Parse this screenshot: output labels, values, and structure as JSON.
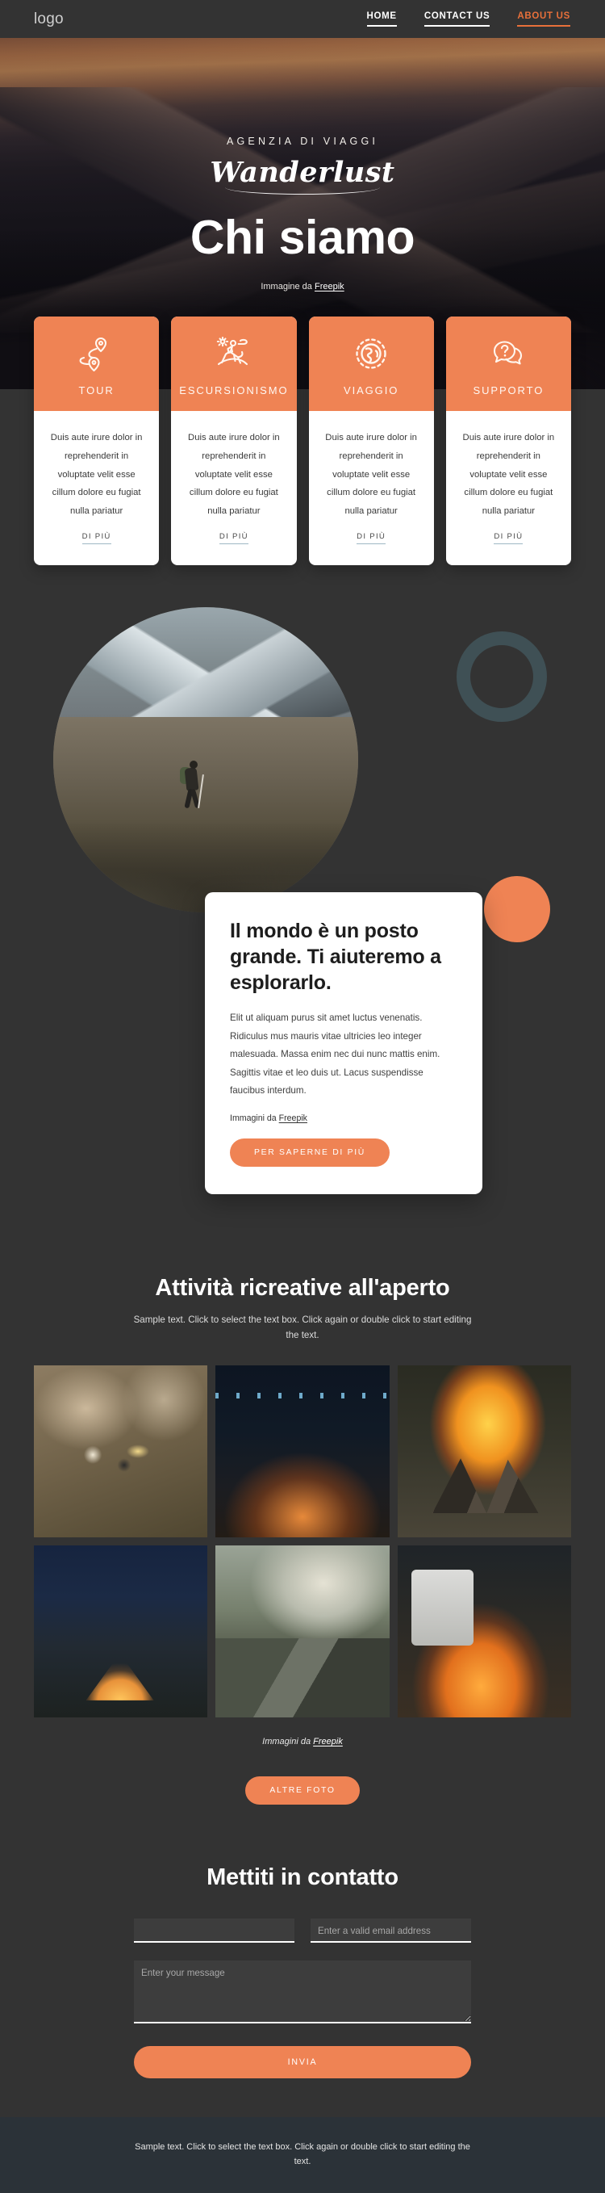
{
  "header": {
    "logo": "logo",
    "nav": [
      {
        "label": "HOME",
        "active": false
      },
      {
        "label": "CONTACT US",
        "active": false
      },
      {
        "label": "ABOUT US",
        "active": true
      }
    ]
  },
  "hero": {
    "eyebrow": "AGENZIA DI VIAGGI",
    "script": "Wanderlust",
    "title": "Chi siamo",
    "credit_prefix": "Immagine da ",
    "credit_link": "Freepik"
  },
  "features": [
    {
      "icon": "route-pin-icon",
      "title": "TOUR",
      "text": "Duis aute irure dolor in reprehenderit in voluptate velit esse cillum dolore eu fugiat nulla pariatur",
      "link": "DI PIÙ"
    },
    {
      "icon": "hiker-icon",
      "title": "ESCURSIONISMO",
      "text": "Duis aute irure dolor in reprehenderit in voluptate velit esse cillum dolore eu fugiat nulla pariatur",
      "link": "DI PIÙ"
    },
    {
      "icon": "globe-icon",
      "title": "VIAGGIO",
      "text": "Duis aute irure dolor in reprehenderit in voluptate velit esse cillum dolore eu fugiat nulla pariatur",
      "link": "DI PIÙ"
    },
    {
      "icon": "chat-question-icon",
      "title": "SUPPORTO",
      "text": "Duis aute irure dolor in reprehenderit in voluptate velit esse cillum dolore eu fugiat nulla pariatur",
      "link": "DI PIÙ"
    }
  ],
  "about": {
    "photo_alt": "hiker-crossing-mountain-valley-photo",
    "heading": "Il mondo è un posto grande. Ti aiuteremo a esplorarlo.",
    "text": "Elit ut aliquam purus sit amet luctus venenatis. Ridiculus mus mauris vitae ultricies leo integer malesuada. Massa enim nec dui nunc mattis enim. Sagittis vitae et leo duis ut. Lacus suspendisse faucibus interdum.",
    "credit_prefix": "Immagini da ",
    "credit_link": "Freepik",
    "button": "PER SAPERNE DI PIÙ"
  },
  "gallery": {
    "title": "Attività ricreative all'aperto",
    "subtitle": "Sample text. Click to select the text box. Click again or double click to start editing the text.",
    "images": [
      {
        "alt": "friends-picnic-camp-food-photo"
      },
      {
        "alt": "friends-roasting-marshmallows-night-photo"
      },
      {
        "alt": "campfire-burning-logs-photo"
      },
      {
        "alt": "illuminated-tent-at-night-photo"
      },
      {
        "alt": "mountain-lake-valley-photo"
      },
      {
        "alt": "couple-by-campfire-van-photo"
      }
    ],
    "credit_prefix": "Immagini da ",
    "credit_link": "Freepik",
    "button": "ALTRE FOTO"
  },
  "contact": {
    "title": "Mettiti in contatto",
    "name_value": "",
    "name_placeholder": "",
    "email_value": "",
    "email_placeholder": "Enter a valid email address",
    "message_value": "",
    "message_placeholder": "Enter your message",
    "submit": "INVIA"
  },
  "footer": {
    "text": "Sample text. Click to select the text box. Click again or double click to start editing the text."
  },
  "colors": {
    "accent": "#ef8354",
    "accent_nav": "#e8703a",
    "page_bg": "#333333",
    "footer_bg": "#2b3238",
    "ring": "#3f5055"
  }
}
